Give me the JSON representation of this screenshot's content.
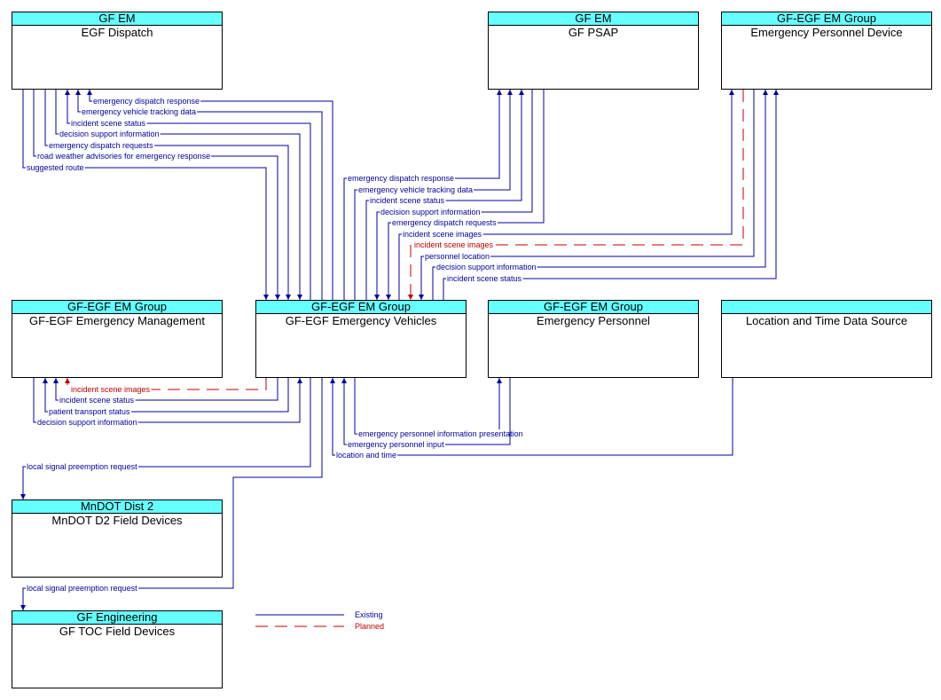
{
  "colors": {
    "existing": "#0000a0",
    "planned": "#c00000",
    "header_fill": "#66ffff"
  },
  "boxes": {
    "egf_dispatch": {
      "group": "GF EM",
      "name": "EGF Dispatch"
    },
    "gf_psap": {
      "group": "GF EM",
      "name": "GF PSAP"
    },
    "emergency_personnel_device": {
      "group": "GF-EGF EM Group",
      "name": "Emergency Personnel Device"
    },
    "emergency_management": {
      "group": "GF-EGF EM Group",
      "name": "GF-EGF Emergency Management"
    },
    "emergency_vehicles": {
      "group": "GF-EGF EM Group",
      "name": "GF-EGF Emergency Vehicles"
    },
    "emergency_personnel": {
      "group": "GF-EGF EM Group",
      "name": "Emergency Personnel"
    },
    "location_time_source": {
      "group": "",
      "name": "Location and Time Data Source"
    },
    "mndot_field_devices": {
      "group": "MnDOT Dist 2",
      "name": "MnDOT D2 Field Devices"
    },
    "gf_toc_field_devices": {
      "group": "GF Engineering",
      "name": "GF TOC Field Devices"
    }
  },
  "flows": [
    {
      "label": "emergency dispatch response",
      "from": "emergency_vehicles",
      "to": "egf_dispatch",
      "status": "existing"
    },
    {
      "label": "emergency vehicle tracking data",
      "from": "emergency_vehicles",
      "to": "egf_dispatch",
      "status": "existing"
    },
    {
      "label": "incident scene status",
      "from": "emergency_vehicles",
      "to": "egf_dispatch",
      "status": "existing"
    },
    {
      "label": "decision support information",
      "from": "egf_dispatch",
      "to": "emergency_vehicles",
      "status": "existing"
    },
    {
      "label": "emergency dispatch requests",
      "from": "egf_dispatch",
      "to": "emergency_vehicles",
      "status": "existing"
    },
    {
      "label": "road weather advisories for emergency response",
      "from": "egf_dispatch",
      "to": "emergency_vehicles",
      "status": "existing"
    },
    {
      "label": "suggested route",
      "from": "egf_dispatch",
      "to": "emergency_vehicles",
      "status": "existing"
    },
    {
      "label": "emergency dispatch response",
      "from": "emergency_vehicles",
      "to": "gf_psap",
      "status": "existing"
    },
    {
      "label": "emergency vehicle tracking data",
      "from": "emergency_vehicles",
      "to": "gf_psap",
      "status": "existing"
    },
    {
      "label": "incident scene status",
      "from": "emergency_vehicles",
      "to": "gf_psap",
      "status": "existing"
    },
    {
      "label": "decision support information",
      "from": "gf_psap",
      "to": "emergency_vehicles",
      "status": "existing"
    },
    {
      "label": "emergency dispatch requests",
      "from": "gf_psap",
      "to": "emergency_vehicles",
      "status": "existing"
    },
    {
      "label": "incident scene images",
      "from": "emergency_vehicles",
      "to": "emergency_personnel_device",
      "status": "existing"
    },
    {
      "label": "incident scene images",
      "from": "emergency_personnel_device",
      "to": "emergency_vehicles",
      "status": "planned"
    },
    {
      "label": "personnel location",
      "from": "emergency_personnel_device",
      "to": "emergency_vehicles",
      "status": "existing"
    },
    {
      "label": "decision support information",
      "from": "emergency_vehicles",
      "to": "emergency_personnel_device",
      "status": "existing"
    },
    {
      "label": "incident scene status",
      "from": "emergency_vehicles",
      "to": "emergency_personnel_device",
      "status": "existing"
    },
    {
      "label": "incident scene images",
      "from": "emergency_vehicles",
      "to": "emergency_management",
      "status": "planned"
    },
    {
      "label": "incident scene status",
      "from": "emergency_vehicles",
      "to": "emergency_management",
      "status": "existing"
    },
    {
      "label": "patient transport status",
      "from": "emergency_vehicles",
      "to": "emergency_management",
      "status": "existing"
    },
    {
      "label": "decision support information",
      "from": "emergency_management",
      "to": "emergency_vehicles",
      "status": "existing"
    },
    {
      "label": "emergency personnel information presentation",
      "from": "emergency_vehicles",
      "to": "emergency_personnel",
      "status": "existing"
    },
    {
      "label": "emergency personnel input",
      "from": "emergency_personnel",
      "to": "emergency_vehicles",
      "status": "existing"
    },
    {
      "label": "location and time",
      "from": "location_time_source",
      "to": "emergency_vehicles",
      "status": "existing"
    },
    {
      "label": "local signal preemption request",
      "from": "emergency_vehicles",
      "to": "mndot_field_devices",
      "status": "existing"
    },
    {
      "label": "local signal preemption request",
      "from": "emergency_vehicles",
      "to": "gf_toc_field_devices",
      "status": "existing"
    }
  ],
  "legend": {
    "existing_label": "Existing",
    "planned_label": "Planned"
  }
}
